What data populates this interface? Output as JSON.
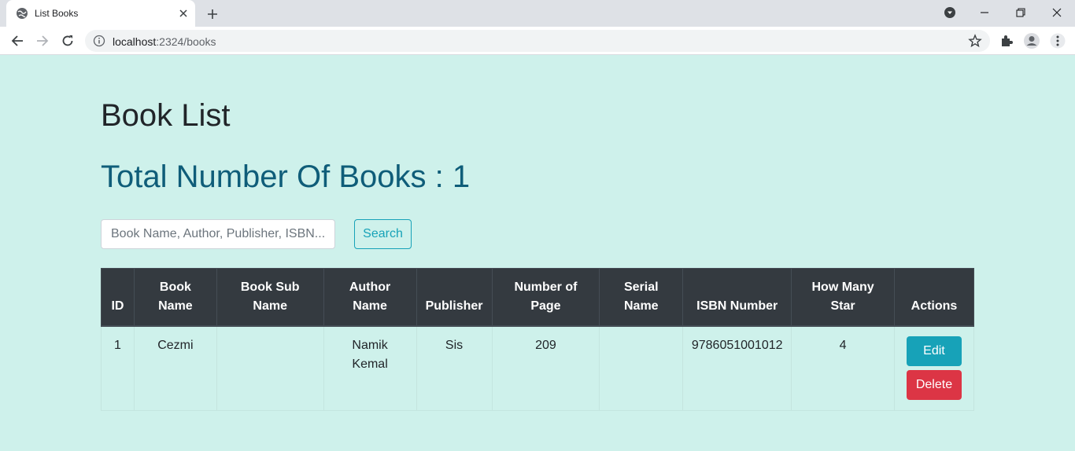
{
  "browser": {
    "tab_title": "List Books",
    "url_host": "localhost",
    "url_path": ":2324/books"
  },
  "page": {
    "title": "Book List",
    "total_label": "Total Number Of Books : 1",
    "search": {
      "placeholder": "Book Name, Author, Publisher, ISBN...",
      "value": "",
      "button_label": "Search"
    }
  },
  "table": {
    "headers": [
      "ID",
      "Book Name",
      "Book Sub Name",
      "Author Name",
      "Publisher",
      "Number of Page",
      "Serial Name",
      "ISBN Number",
      "How Many Star",
      "Actions"
    ],
    "rows": [
      {
        "id": "1",
        "book_name": "Cezmi",
        "book_sub_name": "",
        "author_name": "Namik Kemal",
        "publisher": "Sis",
        "number_of_page": "209",
        "serial_name": "",
        "isbn_number": "9786051001012",
        "how_many_star": "4",
        "edit_label": "Edit",
        "delete_label": "Delete"
      }
    ]
  },
  "colors": {
    "page_background": "#cef1eb",
    "heading_accent": "#0f5d79",
    "table_header": "#343a40",
    "info": "#17a2b8",
    "danger": "#dc3545"
  },
  "icons": [
    "globe-icon",
    "close-icon",
    "plus-icon",
    "profile-dropdown-icon",
    "minimize-icon",
    "restore-icon",
    "back-icon",
    "forward-icon",
    "reload-icon",
    "info-icon",
    "star-icon",
    "extensions-icon",
    "avatar-icon",
    "menu-icon"
  ]
}
